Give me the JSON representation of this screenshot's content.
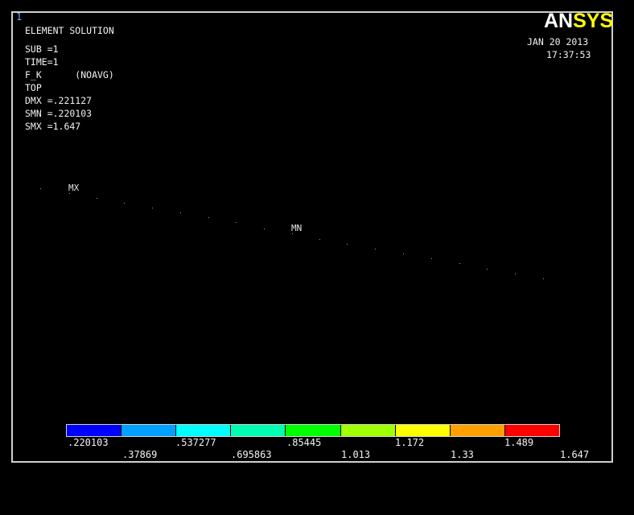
{
  "window_number": "1",
  "logo": {
    "part1": "AN",
    "part2": "SYS"
  },
  "date": "JAN 20 2013",
  "time": "17:37:53",
  "info_lines": [
    "ELEMENT SOLUTION",
    "SUB =1",
    "TIME=1",
    "F_K      (NOAVG)",
    "TOP",
    "DMX =.221127",
    "SMN =.220103",
    "SMX =1.647"
  ],
  "markers": {
    "max": "MX",
    "min": "MN"
  },
  "legend": {
    "colors": [
      "#0000ff",
      "#00a0ff",
      "#00ffff",
      "#00ffb0",
      "#00ff00",
      "#a0ff00",
      "#ffff00",
      "#ffa000",
      "#ff0000"
    ],
    "upper_labels": [
      ".220103",
      ".537277",
      ".85445",
      "1.172",
      "1.489"
    ],
    "lower_labels": [
      ".37869",
      ".695863",
      "1.013",
      "1.33",
      "1.647"
    ]
  }
}
